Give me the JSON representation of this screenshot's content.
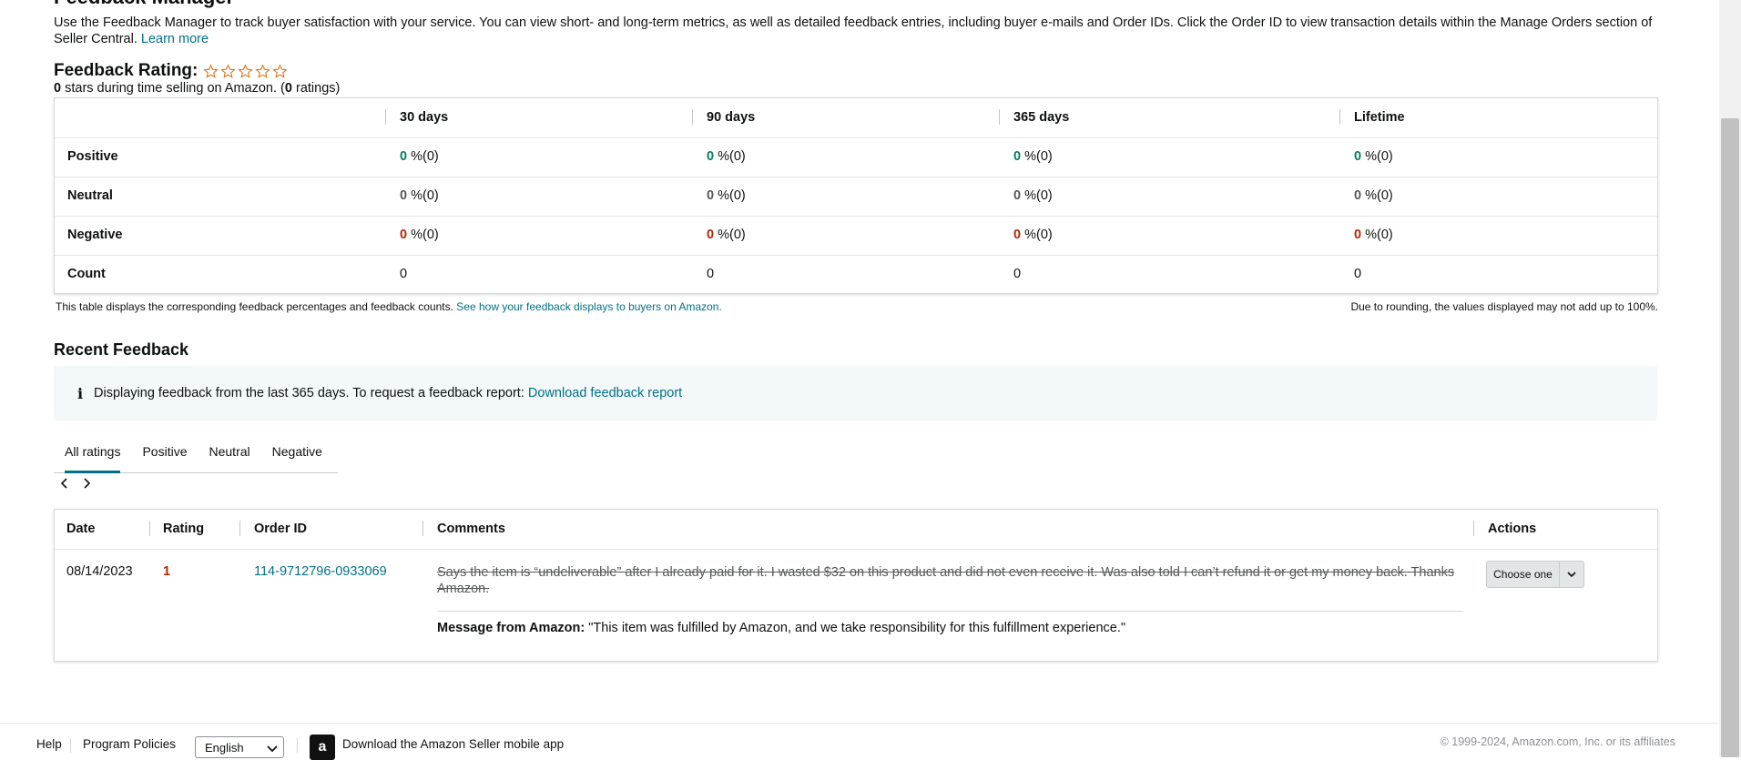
{
  "page": {
    "title": "Feedback Manager",
    "intro": "Use the Feedback Manager to track buyer satisfaction with your service. You can view short- and long-term metrics, as well as detailed feedback entries, including buyer e-mails and Order IDs. Click the Order ID to view transaction details within the Manage Orders section of Seller Central.",
    "learn_more": "Learn more"
  },
  "rating": {
    "label": "Feedback Rating:",
    "stars_count": "0",
    "summary_text": " stars during time selling on Amazon. (",
    "ratings_count": "0",
    "ratings_suffix": " ratings)",
    "star_color": "#de7921"
  },
  "metrics": {
    "columns": [
      "30 days",
      "90 days",
      "365 days",
      "Lifetime"
    ],
    "rows": [
      {
        "label": "Positive",
        "cells": [
          {
            "n": "0",
            "p": " %(0)"
          },
          {
            "n": "0",
            "p": " %(0)"
          },
          {
            "n": "0",
            "p": " %(0)"
          },
          {
            "n": "0",
            "p": " %(0)"
          }
        ]
      },
      {
        "label": "Neutral",
        "cells": [
          {
            "n": "0",
            "p": " %(0)"
          },
          {
            "n": "0",
            "p": " %(0)"
          },
          {
            "n": "0",
            "p": " %(0)"
          },
          {
            "n": "0",
            "p": " %(0)"
          }
        ]
      },
      {
        "label": "Negative",
        "cells": [
          {
            "n": "0",
            "p": " %(0)"
          },
          {
            "n": "0",
            "p": " %(0)"
          },
          {
            "n": "0",
            "p": " %(0)"
          },
          {
            "n": "0",
            "p": " %(0)"
          }
        ]
      },
      {
        "label": "Count",
        "cells": [
          {
            "n": "0",
            "p": ""
          },
          {
            "n": "0",
            "p": ""
          },
          {
            "n": "0",
            "p": ""
          },
          {
            "n": "0",
            "p": ""
          }
        ]
      }
    ],
    "footnote": "This table displays the corresponding feedback percentages and feedback counts.",
    "footnote_link": "See how your feedback displays to buyers on Amazon.",
    "rounding_note": "Due to rounding, the values displayed may not add up to 100%."
  },
  "recent": {
    "title": "Recent Feedback",
    "info_icon": "i",
    "info_text": "Displaying feedback from the last 365 days. To request a feedback report:",
    "info_link": "Download feedback report",
    "tabs": [
      "All ratings",
      "Positive",
      "Neutral",
      "Negative"
    ],
    "active_tab": "All ratings",
    "table": {
      "headers": [
        "Date",
        "Rating",
        "Order ID",
        "Comments",
        "Actions"
      ],
      "row": {
        "date": "08/14/2023",
        "rating": "1",
        "order_id": "114-9712796-0933069",
        "comment": "Says the item is “undeliverable” after I already paid for it. I wasted $32 on this product and did not even receive it. Was also told I can’t refund it or get my money back. Thanks Amazon.",
        "amazon_label": "Message from Amazon:",
        "amazon_message": " \"This item was fulfilled by Amazon, and we take responsibility for this fulfillment experience.\"",
        "action_label": "Choose one"
      }
    }
  },
  "footer": {
    "help": "Help",
    "program_policies": "Program Policies",
    "language": "English",
    "app_text": "Download the Amazon Seller mobile app",
    "app_glyph": "a",
    "copyright": "© 1999-2024, Amazon.com, Inc. or its affiliates"
  }
}
